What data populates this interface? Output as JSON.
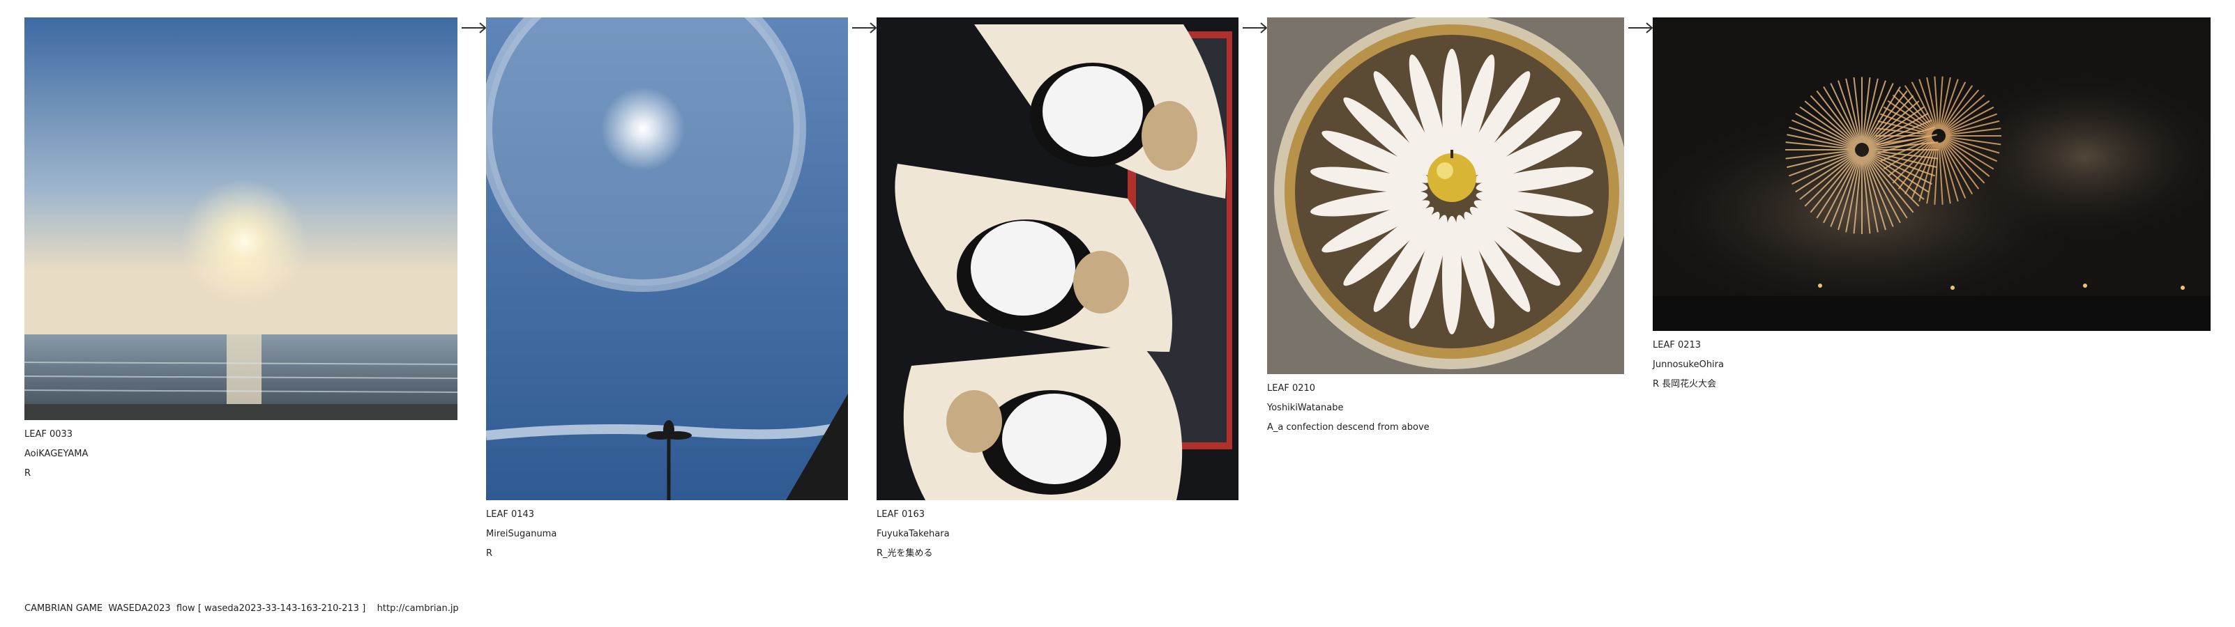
{
  "leaves": [
    {
      "id": "LEAF 0033",
      "author": "AoiKAGEYAMA",
      "title": "R"
    },
    {
      "id": "LEAF 0143",
      "author": "MireiSuganuma",
      "title": "R"
    },
    {
      "id": "LEAF 0163",
      "author": "FuyukaTakehara",
      "title": "R_光を集める"
    },
    {
      "id": "LEAF 0210",
      "author": "YoshikiWatanabe",
      "title": "A_a confection descend from above"
    },
    {
      "id": "LEAF 0213",
      "author": "JunnosukeOhira",
      "title": "R 長岡花火大会"
    }
  ],
  "arrow_icon": "arrow-right-icon",
  "footer": {
    "text": "CAMBRIAN GAME  WASEDA2023  flow [ waseda2023-33-143-163-210-213 ]    http://cambrian.jp"
  }
}
